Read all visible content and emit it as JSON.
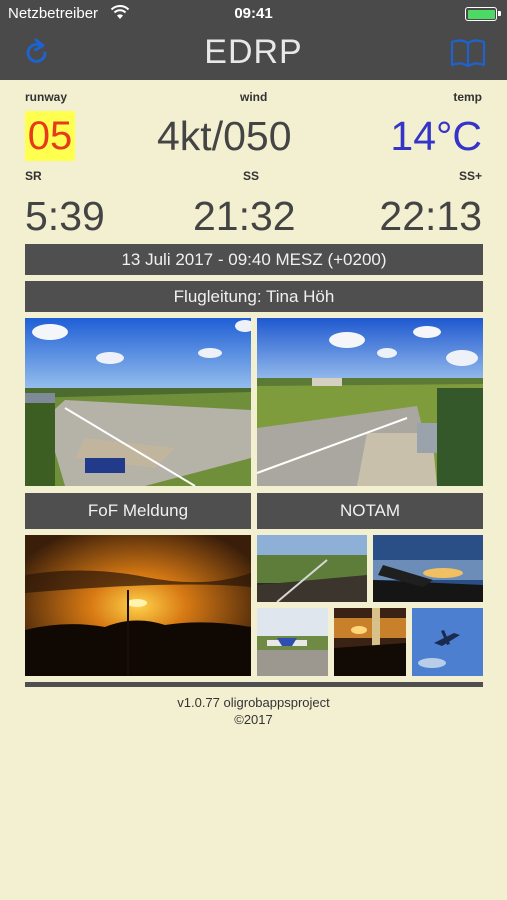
{
  "statusbar": {
    "carrier": "Netzbetreiber",
    "time": "09:41"
  },
  "navbar": {
    "title": "EDRP",
    "refresh_icon": "refresh-icon",
    "book_icon": "book-icon"
  },
  "weather": {
    "runway_label": "runway",
    "runway_value": "05",
    "wind_label": "wind",
    "wind_value": "4kt/050",
    "temp_label": "temp",
    "temp_value": "14°C"
  },
  "sun": {
    "sr_label": "SR",
    "sr_value": "5:39",
    "ss_label": "SS",
    "ss_value": "21:32",
    "ssplus_label": "SS+",
    "ssplus_value": "22:13"
  },
  "info": {
    "datetime": "13 Juli 2017 - 09:40 MESZ (+0200)",
    "flight_lead": "Flugleitung: Tina Höh"
  },
  "buttons": {
    "fof": "FoF Meldung",
    "notam": "NOTAM"
  },
  "footer": {
    "version": "v1.0.77 oligrobappsproject",
    "copyright": "©2017"
  },
  "colors": {
    "background": "#f3f0d2",
    "bar": "#4a4a4a",
    "accent": "#1e62d0",
    "runway_highlight": "#ffff4f",
    "runway_text": "#e53a1b",
    "temp_text": "#3434c8"
  }
}
